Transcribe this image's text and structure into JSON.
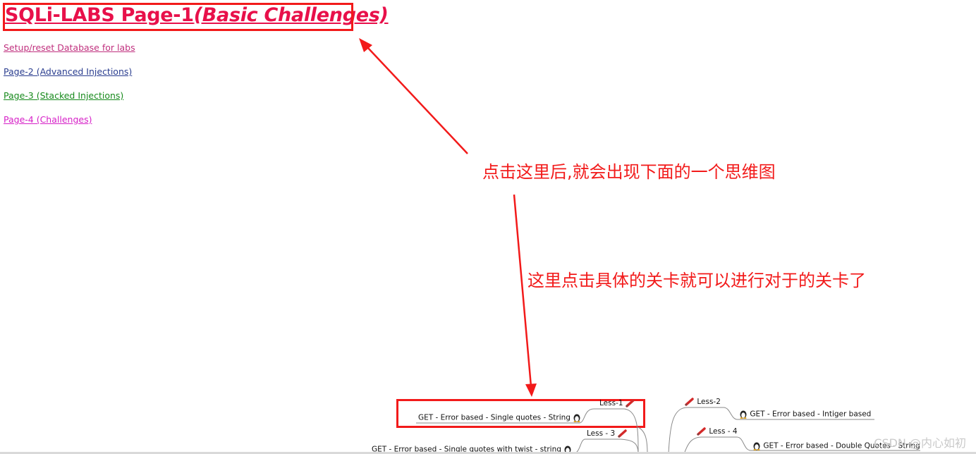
{
  "page": {
    "title_main": "SQLi-LABS Page-1",
    "title_sub": "(Basic Challenges)"
  },
  "nav": [
    {
      "label": "Setup/reset Database for labs",
      "color": "#c0307e"
    },
    {
      "label": "Page-2 (Advanced Injections)",
      "color": "#2a3d8f"
    },
    {
      "label": "Page-3 (Stacked Injections)",
      "color": "#178a1c"
    },
    {
      "label": "Page-4 (Challenges)",
      "color": "#d61fc7"
    }
  ],
  "annotations": {
    "note1": "点击这里后,就会出现下面的一个思维图",
    "note2": "这里点击具体的关卡就可以进行对于的关卡了",
    "color": "#f21a1a"
  },
  "mindmap": {
    "less1": {
      "name": "Less-1",
      "desc": "GET - Error based - Single quotes - String"
    },
    "less2": {
      "name": "Less-2",
      "desc": "GET - Error based - Intiger based"
    },
    "less3": {
      "name": "Less - 3",
      "desc": "GET - Error based - Single quotes with twist - string"
    },
    "less4": {
      "name": "Less - 4",
      "desc": "GET - Error based - Double Quotes - String"
    }
  },
  "watermark": "CSDN @内心如初"
}
